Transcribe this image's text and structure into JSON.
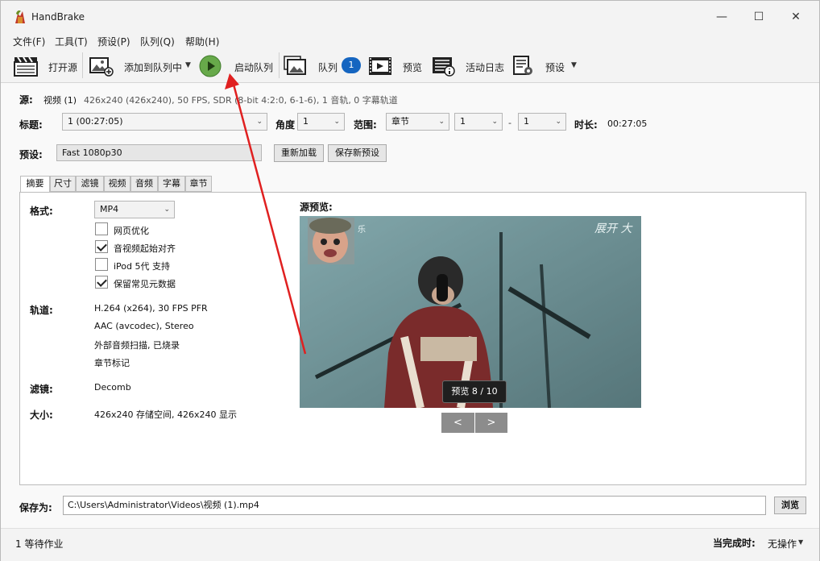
{
  "window": {
    "title": "HandBrake",
    "min": "—",
    "max": "☐",
    "close": "✕"
  },
  "menu": [
    "文件(F)",
    "工具(T)",
    "预设(P)",
    "队列(Q)",
    "帮助(H)"
  ],
  "toolbar": {
    "open_source": "打开源",
    "add_to_queue": "添加到队列中",
    "start_queue": "启动队列",
    "queue": "队列",
    "queue_count": "1",
    "preview": "预览",
    "activity_log": "活动日志",
    "presets": "预设"
  },
  "source": {
    "label": "源:",
    "name": "视频 (1)",
    "info": "426x240 (426x240), 50 FPS, SDR (8-bit 4:2:0, 6-1-6), 1 音轨, 0 字幕轨道"
  },
  "title_row": {
    "title_label": "标题:",
    "title_value": "1  (00:27:05)",
    "angle_label": "角度",
    "angle_value": "1",
    "range_label": "范围:",
    "range_type": "章节",
    "range_start": "1",
    "range_sep": "-",
    "range_end": "1",
    "duration_label": "时长:",
    "duration_value": "00:27:05"
  },
  "preset": {
    "label": "预设:",
    "value": "Fast 1080p30",
    "reload": "重新加载",
    "save_new": "保存新预设"
  },
  "tabs": [
    "摘要",
    "尺寸",
    "滤镜",
    "视频",
    "音频",
    "字幕",
    "章节"
  ],
  "summary": {
    "format_label": "格式:",
    "format_value": "MP4",
    "options": [
      {
        "label": "网页优化",
        "checked": false
      },
      {
        "label": "音视频起始对齐",
        "checked": true
      },
      {
        "label": "iPod 5代 支持",
        "checked": false
      },
      {
        "label": "保留常见元数据",
        "checked": true
      }
    ],
    "tracks_label": "轨道:",
    "tracks": [
      "H.264 (x264), 30 FPS PFR",
      "AAC (avcodec), Stereo",
      "外部音频扫描, 已烧录",
      "章节标记"
    ],
    "filters_label": "滤镜:",
    "filters_value": "Decomb",
    "size_label": "大小:",
    "size_value": "426x240 存储空间, 426x240 显示"
  },
  "preview_panel": {
    "label": "源预览:",
    "badge": "预览 8 / 10",
    "prev": "<",
    "next": ">",
    "overlay_text": "展开  大",
    "overlay_small": "乐"
  },
  "save": {
    "label": "保存为:",
    "path": "C:\\Users\\Administrator\\Videos\\视频 (1).mp4",
    "browse": "浏览"
  },
  "status": {
    "jobs": "1 等待作业",
    "when_done_label": "当完成时:",
    "when_done_value": "无操作"
  }
}
